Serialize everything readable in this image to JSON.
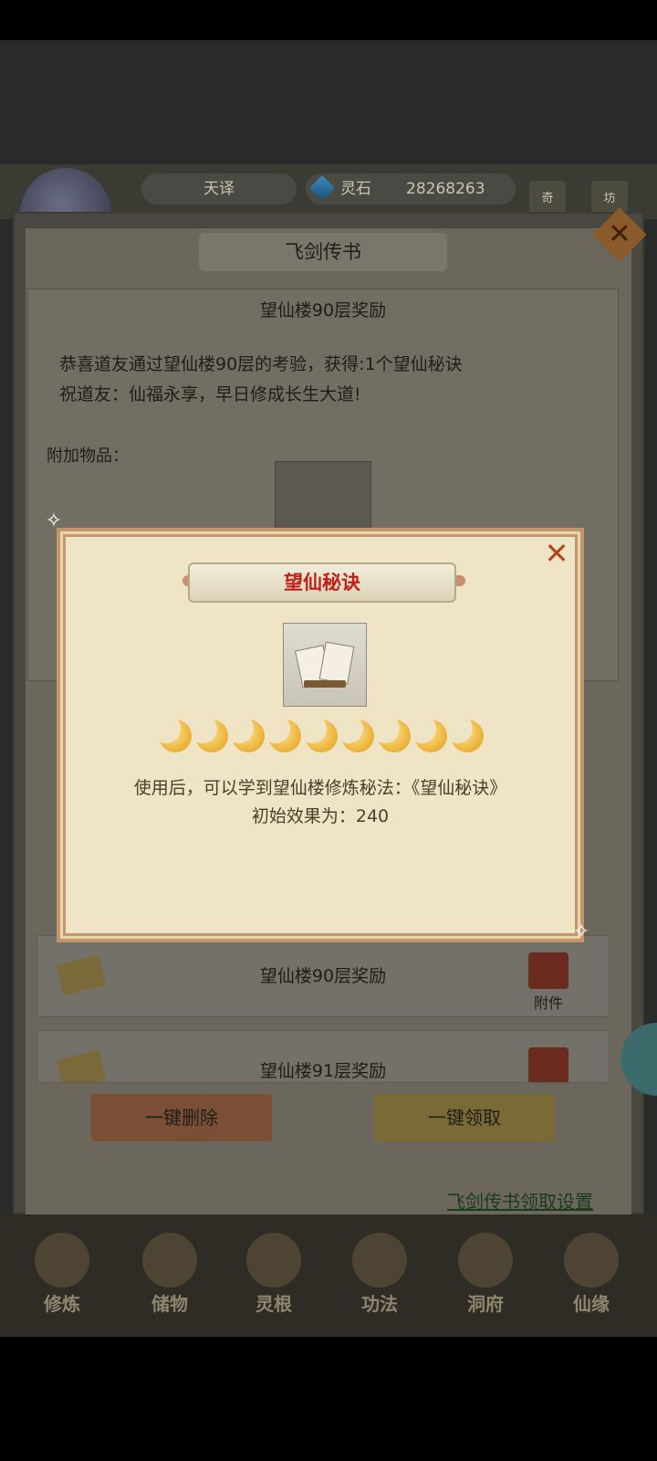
{
  "hud": {
    "nickname": "天译",
    "currency_label": "灵石",
    "currency_value": "28268263",
    "side_btn_1": "奇",
    "side_btn_2": "坊"
  },
  "panel": {
    "title": "飞剑传书",
    "close_icon": "close-icon"
  },
  "mail": {
    "subject": "望仙楼90层奖励",
    "body_line1": "恭喜道友通过望仙楼90层的考验，获得:1个望仙秘诀",
    "body_line2": "祝道友：仙福永享，早日修成长生大道!",
    "attach_label": "附加物品："
  },
  "list": [
    {
      "title": "望仙楼90层奖励",
      "gift_label": "附件"
    },
    {
      "title": "望仙楼91层奖励",
      "gift_label": ""
    }
  ],
  "buttons": {
    "delete_all": "一键删除",
    "claim_all": "一键领取",
    "settings_link": "飞剑传书领取设置"
  },
  "popup": {
    "title": "望仙秘诀",
    "stars": 9,
    "desc_line1": "使用后，可以学到望仙楼修炼秘法：《望仙秘诀》",
    "desc_line2": "初始效果为：240"
  },
  "bottom_nav": [
    "修炼",
    "储物",
    "灵根",
    "功法",
    "洞府",
    "仙缘"
  ],
  "colors": {
    "popup_title": "#c0211b",
    "settings_link": "#1b3a1a",
    "star": "#f0b429"
  }
}
